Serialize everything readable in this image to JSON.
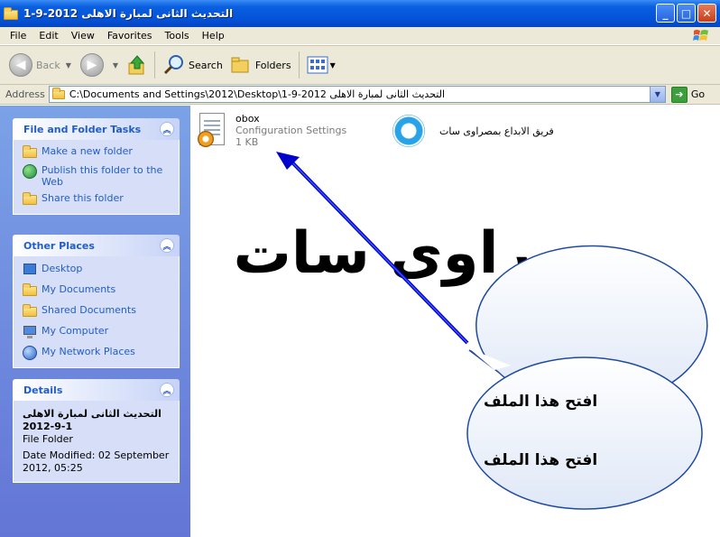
{
  "window": {
    "title": "التحديث الثانى لمبارة الاهلى 2012-9-1",
    "min_glyph": "_",
    "max_glyph": "□",
    "close_glyph": "✕"
  },
  "menu": [
    "File",
    "Edit",
    "View",
    "Favorites",
    "Tools",
    "Help"
  ],
  "toolbar": {
    "back_label": "Back",
    "search_label": "Search",
    "folders_label": "Folders"
  },
  "address": {
    "label": "Address",
    "path": "C:\\Documents and Settings\\2012\\Desktop\\التحديث الثانى لمبارة الاهلى 2012-9-1",
    "go_label": "Go"
  },
  "tasks": {
    "heading": "File and Folder Tasks",
    "items": [
      {
        "label": "Make a new folder",
        "icon": "new-folder-icon"
      },
      {
        "label": "Publish this folder to the Web",
        "icon": "publish-web-icon"
      },
      {
        "label": "Share this folder",
        "icon": "share-folder-icon"
      }
    ]
  },
  "places": {
    "heading": "Other Places",
    "items": [
      {
        "label": "Desktop",
        "icon": "desktop-icon"
      },
      {
        "label": "My Documents",
        "icon": "my-documents-icon"
      },
      {
        "label": "Shared Documents",
        "icon": "shared-documents-icon"
      },
      {
        "label": "My Computer",
        "icon": "my-computer-icon"
      },
      {
        "label": "My Network Places",
        "icon": "network-places-icon"
      }
    ]
  },
  "details": {
    "heading": "Details",
    "name": "التحديث الثانى لمبارة الاهلى 1-9-2012",
    "type": "File Folder",
    "modified": "Date Modified: 02 September 2012, 05:25"
  },
  "files": [
    {
      "name": "obox",
      "type": "Configuration Settings",
      "size": "1 KB",
      "icon": "config-settings-icon"
    },
    {
      "name": "فريق الابداع بمصراوى سات",
      "icon": "o-logo-icon"
    }
  ],
  "overlay": {
    "big_text": "مصراوى سات",
    "bubble_line1": "افتح هذا الملف",
    "bubble_line2": "افتح هذا الملف",
    "arrow_color": "#0000cc"
  }
}
